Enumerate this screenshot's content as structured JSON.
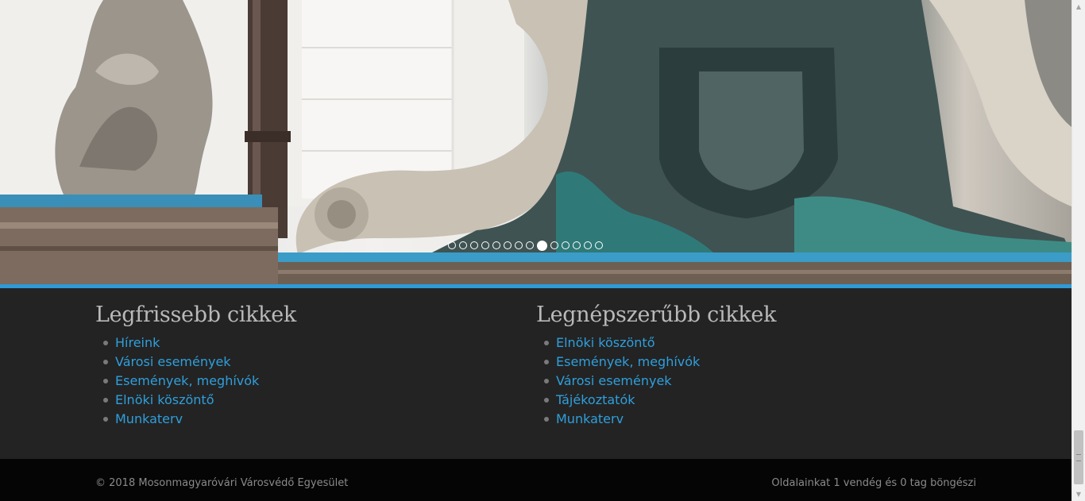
{
  "slider": {
    "slide_count": 14,
    "active_index": 8,
    "accent_color": "#2e9ad6"
  },
  "latest": {
    "title": "Legfrissebb cikkek",
    "items": [
      "Híreink",
      "Városi események",
      "Események, meghívók",
      "Elnöki köszöntő",
      "Munkaterv"
    ]
  },
  "popular": {
    "title": "Legnépszerűbb cikkek",
    "items": [
      "Elnöki köszöntő",
      "Események, meghívók",
      "Városi események",
      "Tájékoztatók",
      "Munkaterv"
    ]
  },
  "footer": {
    "copyright": "© 2018 Mosonmagyaróvári Városvédő Egyesület",
    "visitors": "Oldalainkat 1 vendég és 0 tag böngészi"
  },
  "colors": {
    "link": "#2f9fdc",
    "section_bg": "#232323",
    "footer_bg": "#050505"
  }
}
